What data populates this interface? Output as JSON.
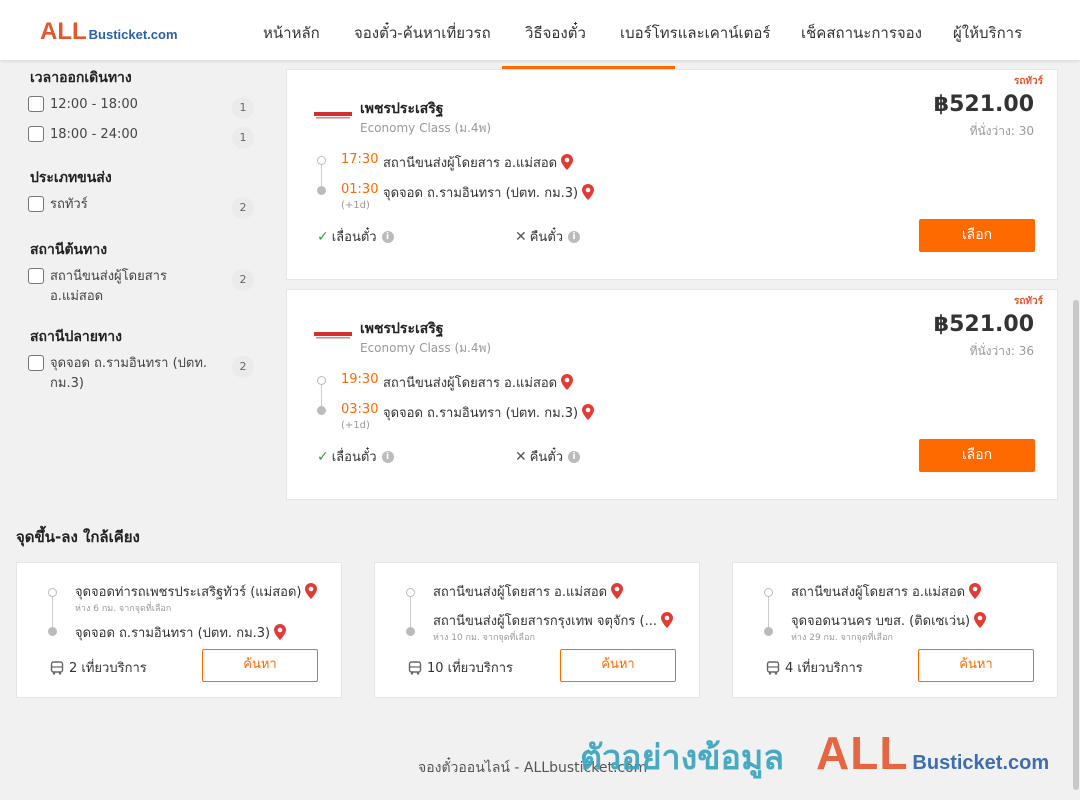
{
  "brand": {
    "logo_main": "ALL",
    "logo_sub": "Busticket.com"
  },
  "nav": {
    "items": [
      "หน้าหลัก",
      "จองตั๋ว-ค้นหาเที่ยวรถ",
      "วิธีจองตั๋ว",
      "เบอร์โทรและเคาน์เตอร์",
      "เช็คสถานะการจอง",
      "ผู้ให้บริการ"
    ],
    "active": "วิธีจองตั๋ว"
  },
  "filters": {
    "departure_time": {
      "title": "เวลาออกเดินทาง",
      "options": [
        {
          "label": "12:00 - 18:00",
          "count": "1"
        },
        {
          "label": "18:00 - 24:00",
          "count": "1"
        }
      ]
    },
    "transport_type": {
      "title": "ประเภทขนส่ง",
      "options": [
        {
          "label": "รถทัวร์",
          "count": "2"
        }
      ]
    },
    "origin": {
      "title": "สถานีต้นทาง",
      "options": [
        {
          "label": "สถานีขนส่งผู้โดยสาร อ.แม่สอด",
          "count": "2"
        }
      ]
    },
    "destination": {
      "title": "สถานีปลายทาง",
      "options": [
        {
          "label": "จุดจอด ถ.รามอินทรา (ปตท. กม.3)",
          "count": "2"
        }
      ]
    }
  },
  "trips": [
    {
      "tag": "รถทัวร์",
      "operator": "เพชรประเสริฐ",
      "class": "Economy Class (ม.4พ)",
      "price": "฿521.00",
      "seats": "ที่นั่งว่าง: 30",
      "depart_time": "17:30",
      "depart_station": "สถานีขนส่งผู้โดยสาร อ.แม่สอด",
      "arrive_time": "01:30",
      "arrive_station": "จุดจอด ถ.รามอินทรา (ปตท. กม.3)",
      "day_offset": "(+1d)",
      "reschedule": "เลื่อนตั๋ว",
      "refund": "คืนตั๋ว",
      "select_label": "เลือก"
    },
    {
      "tag": "รถทัวร์",
      "operator": "เพชรประเสริฐ",
      "class": "Economy Class (ม.4พ)",
      "price": "฿521.00",
      "seats": "ที่นั่งว่าง: 36",
      "depart_time": "19:30",
      "depart_station": "สถานีขนส่งผู้โดยสาร อ.แม่สอด",
      "arrive_time": "03:30",
      "arrive_station": "จุดจอด ถ.รามอินทรา (ปตท. กม.3)",
      "day_offset": "(+1d)",
      "reschedule": "เลื่อนตั๋ว",
      "refund": "คืนตั๋ว",
      "select_label": "เลือก"
    }
  ],
  "nearby": {
    "title": "จุดขึ้น-ลง ใกล้เคียง",
    "cards": [
      {
        "from": "จุดจอดท่ารถเพชรประเสริฐทัวร์ (แม่สอด)",
        "from_dist": "ห่าง 6 กม. จากจุดที่เลือก",
        "to": "จุดจอด ถ.รามอินทรา (ปตท. กม.3)",
        "to_dist": "",
        "count": "2 เที่ยวบริการ",
        "search_label": "ค้นหา"
      },
      {
        "from": "สถานีขนส่งผู้โดยสาร อ.แม่สอด",
        "from_dist": "",
        "to": "สถานีขนส่งผู้โดยสารกรุงเทพ จตุจักร (...",
        "to_dist": "ห่าง 10 กม. จากจุดที่เลือก",
        "count": "10 เที่ยวบริการ",
        "search_label": "ค้นหา"
      },
      {
        "from": "สถานีขนส่งผู้โดยสาร อ.แม่สอด",
        "from_dist": "",
        "to": "จุดจอดนวนคร บขส. (ติดเซเว่น)",
        "to_dist": "ห่าง 29 กม. จากจุดที่เลือก",
        "count": "4 เที่ยวบริการ",
        "search_label": "ค้นหา"
      }
    ]
  },
  "footer": {
    "text": "จองตั๋วออนไลน์ - ALLbusticket.com"
  },
  "watermark": {
    "text": "ตัวอย่างข้อมูล",
    "logo_main": "ALL",
    "logo_sub": "Busticket.com"
  },
  "colors": {
    "accent": "#ff6a00",
    "brand_red": "#e4572e",
    "brand_blue": "#2c5fa8",
    "pin": "#e53935"
  }
}
